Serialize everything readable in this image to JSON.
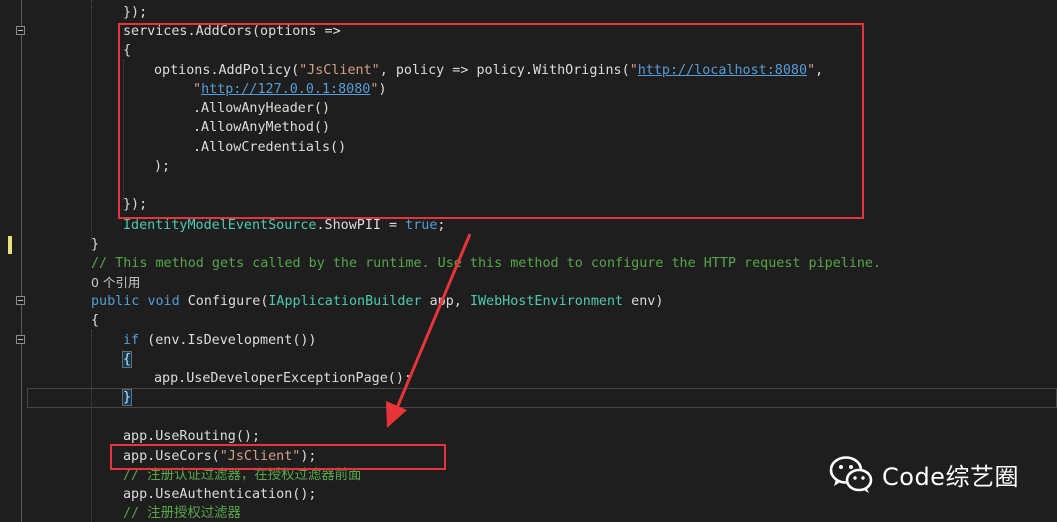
{
  "code": {
    "l01": {
      "text": "});"
    },
    "l02": {
      "id1": "services",
      "dot1": ".",
      "m1": "AddCors",
      "rest": "(options =>"
    },
    "l03": {
      "text": "{"
    },
    "l04": {
      "id1": "options",
      "dot1": ".",
      "m1": "AddPolicy",
      "p1": "(",
      "s1": "\"JsClient\"",
      "p2": ", policy => policy.",
      "m2": "WithOrigins",
      "p3": "(",
      "q1": "\"",
      "u1": "http://localhost:8080",
      "q2": "\"",
      "p4": ","
    },
    "l05": {
      "q1": "\"",
      "u1": "http://127.0.0.1:8080",
      "q2": "\"",
      "p1": ")"
    },
    "l06": {
      "text": ".AllowAnyHeader()"
    },
    "l07": {
      "text": ".AllowAnyMethod()"
    },
    "l08": {
      "text": ".AllowCredentials()"
    },
    "l09": {
      "text": ");"
    },
    "l10": {
      "text": "});"
    },
    "l11": {
      "t1": "IdentityModelEventSource",
      "p1": ".ShowPII = ",
      "k1": "true",
      "p2": ";"
    },
    "l12": {
      "text": "}"
    },
    "l13": {
      "comment": "// This method gets called by the runtime. Use this method to configure the HTTP request pipeline."
    },
    "l14": {
      "refs": "0 个引用"
    },
    "l15": {
      "k1": "public",
      "k2": "void",
      "m1": "Configure",
      "p1": "(",
      "t1": "IApplicationBuilder",
      "p2": " app, ",
      "t2": "IWebHostEnvironment",
      "p3": " env)"
    },
    "l16": {
      "text": "{"
    },
    "l17": {
      "k1": "if",
      "p1": " (env.",
      "m1": "IsDevelopment",
      "p2": "())"
    },
    "l18": {
      "text": "{"
    },
    "l19": {
      "text": "app.UseDeveloperExceptionPage();"
    },
    "l20": {
      "text": "}"
    },
    "l21": {
      "text": "app.UseRouting();"
    },
    "l22": {
      "p1": "app.UseCors(",
      "s1": "\"JsClient\"",
      "p2": ");"
    },
    "l23": {
      "comment": "// 注册认证过滤器，在授权过滤器前面"
    },
    "l24": {
      "text": "app.UseAuthentication();"
    },
    "l25": {
      "comment": "// 注册授权过滤器"
    }
  },
  "watermark": {
    "icon": "wechat-icon",
    "text": "Code综艺圈"
  },
  "colors": {
    "background": "#1e1e1e",
    "highlight": "#e8333a",
    "keyword": "#569cd6",
    "type": "#4ec9b0",
    "string": "#d69d85",
    "comment": "#57a64a"
  }
}
